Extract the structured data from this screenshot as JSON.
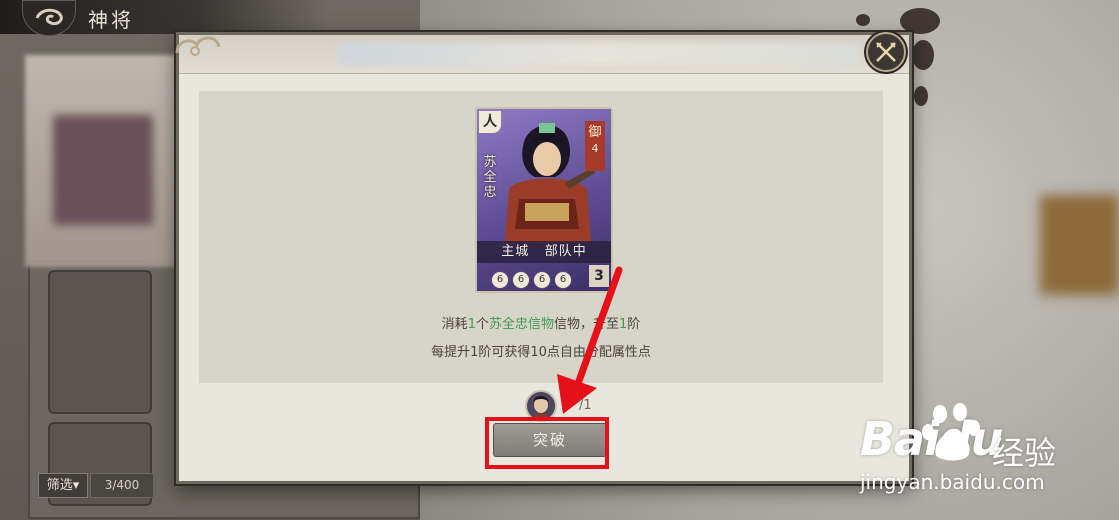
{
  "header": {
    "title": "神将"
  },
  "left_panel": {
    "filter_label": "筛选▾",
    "count": "3/400"
  },
  "dialog": {
    "card": {
      "tag": "人",
      "name": "苏全忠",
      "type_char": "御",
      "type_level": "4",
      "location_city": "主城",
      "location_status": "部队中",
      "star_glyph": "6",
      "level": "3"
    },
    "info": {
      "line1_prefix": "消耗",
      "line1_qty": "1",
      "line1_unit": "个",
      "line1_item": "苏全忠信物",
      "line1_suffix": "信物，升至",
      "line1_target": "1",
      "line1_end": "阶",
      "line2": "每提升1阶可获得10点自由分配属性点"
    },
    "cost_count": "/1",
    "button_label": "突破"
  },
  "watermark": {
    "brand": "Baidu",
    "brand_cn": "经验",
    "url": "jingyan.baidu.com"
  },
  "colors": {
    "highlight": "#e6101b",
    "accent_green": "#3e9a54"
  }
}
